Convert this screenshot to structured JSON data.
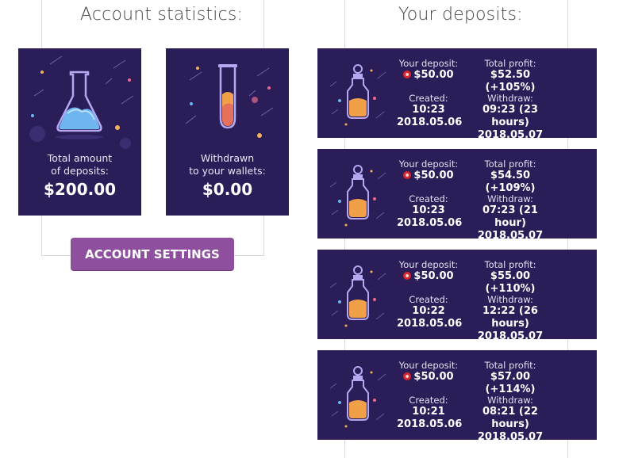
{
  "left": {
    "title": "Account statistics:",
    "cards": [
      {
        "label_line1": "Total amount",
        "label_line2": "of deposits:",
        "value": "$200.00",
        "icon": "flask-icon"
      },
      {
        "label_line1": "Withdrawn",
        "label_line2": "to your wallets:",
        "value": "$0.00",
        "icon": "test-tube-icon"
      }
    ],
    "settings_button": "ACCOUNT SETTINGS"
  },
  "right": {
    "title": "Your deposits:",
    "labels": {
      "deposit": "Your deposit:",
      "profit": "Total profit:",
      "created": "Created:",
      "withdraw": "Withdraw:"
    },
    "payment_icon": "perfect-money-icon",
    "deposits": [
      {
        "amount": "$50.00",
        "profit": "$52.50 (+105%)",
        "created_time": "10:23",
        "created_date": "2018.05.06",
        "withdraw_time": "09:23 (23 hours)",
        "withdraw_date": "2018.05.07"
      },
      {
        "amount": "$50.00",
        "profit": "$54.50 (+109%)",
        "created_time": "10:23",
        "created_date": "2018.05.06",
        "withdraw_time": "07:23 (21 hour)",
        "withdraw_date": "2018.05.07"
      },
      {
        "amount": "$50.00",
        "profit": "$55.00 (+110%)",
        "created_time": "10:22",
        "created_date": "2018.05.06",
        "withdraw_time": "12:22 (26 hours)",
        "withdraw_date": "2018.05.07"
      },
      {
        "amount": "$50.00",
        "profit": "$57.00 (+114%)",
        "created_time": "10:21",
        "created_date": "2018.05.06",
        "withdraw_time": "08:21 (22 hours)",
        "withdraw_date": "2018.05.07"
      }
    ]
  },
  "colors": {
    "card_bg": "#2b1d58",
    "button": "#8f4f9f",
    "badge": "#d8262c"
  }
}
